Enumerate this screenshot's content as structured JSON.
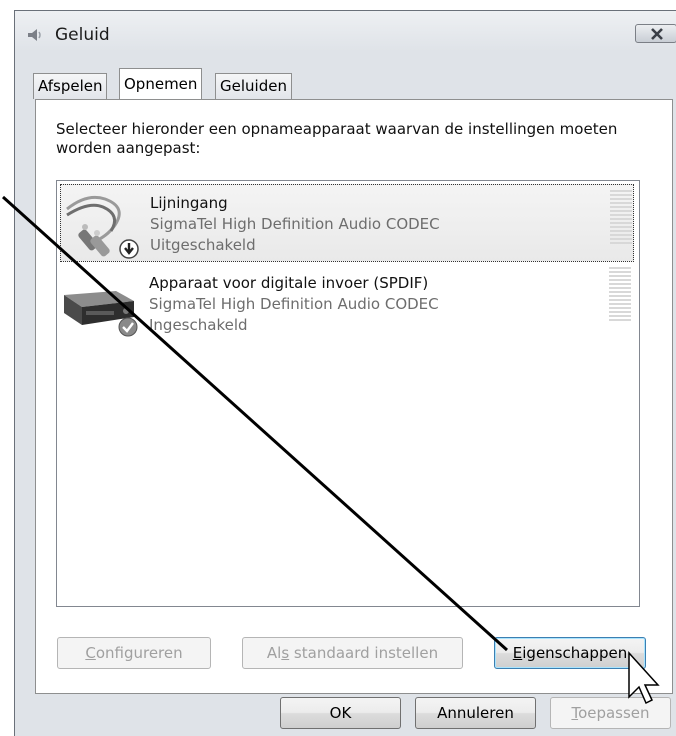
{
  "window": {
    "title": "Geluid"
  },
  "tabs": [
    {
      "label": "Afspelen"
    },
    {
      "label": "Opnemen",
      "active": true
    },
    {
      "label": "Geluiden"
    }
  ],
  "panel": {
    "instruction": "Selecteer hieronder een opnameapparaat waarvan de instellingen moeten worden aangepast:",
    "devices": [
      {
        "name": "Lijningang",
        "driver": "SigmaTel High Definition Audio CODEC",
        "status": "Uitgeschakeld",
        "selected": true,
        "icon": "line-in-cable-icon",
        "badge": "disabled-arrow-badge-icon"
      },
      {
        "name": "Apparaat voor digitale invoer (SPDIF)",
        "driver": "SigmaTel High Definition Audio CODEC",
        "status": "Ingeschakeld",
        "selected": false,
        "icon": "spdif-device-icon",
        "badge": "enabled-check-badge-icon"
      }
    ],
    "buttons": {
      "configure": {
        "pre": "",
        "key": "C",
        "post": "onfigureren"
      },
      "set_default": {
        "pre": "Al",
        "key": "s",
        "post": " standaard instellen"
      },
      "properties": {
        "pre": "",
        "key": "E",
        "post": "igenschappen"
      }
    }
  },
  "footer": {
    "ok": "OK",
    "cancel": "Annuleren",
    "apply": {
      "key": "T",
      "post": "oepassen"
    }
  },
  "colors": {
    "focus_border": "#3c7fb1",
    "disabled_text": "#a0a0a0",
    "annotation_line": "#000000"
  }
}
